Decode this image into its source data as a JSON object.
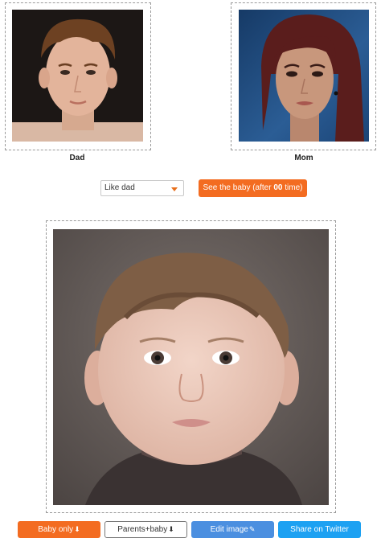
{
  "parents": {
    "dad_label": "Dad",
    "mom_label": "Mom"
  },
  "controls": {
    "like_select_value": "Like dad",
    "see_baby_prefix": "See the baby (after ",
    "see_baby_count": "00",
    "see_baby_suffix": " time)"
  },
  "actions": {
    "baby_only": "Baby only",
    "parents_baby": "Parents+baby",
    "edit_image": "Edit image",
    "share_twitter": "Share on Twitter"
  },
  "icons": {
    "download": "download-icon",
    "edit": "edit-icon",
    "dropdown": "chevron-down-icon"
  },
  "colors": {
    "accent_orange": "#f36c21",
    "edit_blue": "#4b8fe0",
    "twitter_blue": "#1da1f2"
  }
}
